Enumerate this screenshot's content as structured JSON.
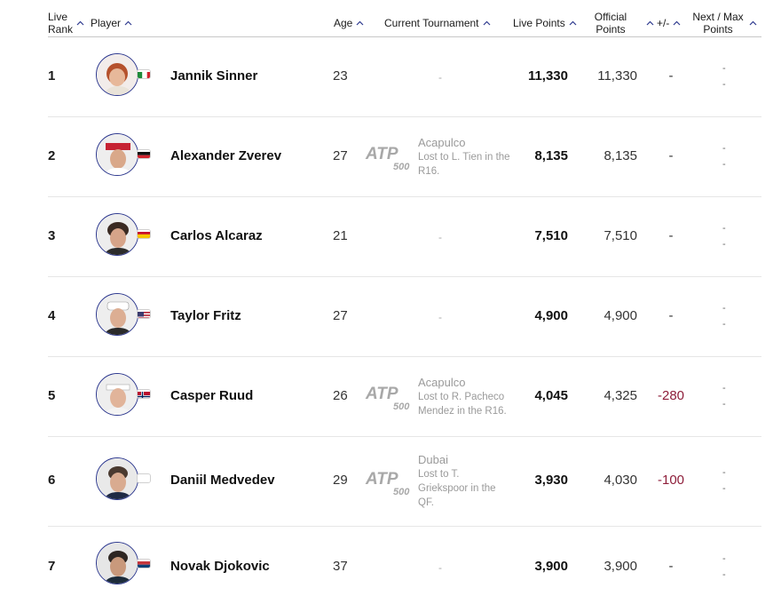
{
  "columns": {
    "live_rank": [
      "Live",
      "Rank"
    ],
    "player": "Player",
    "age": "Age",
    "current_tournament": "Current Tournament",
    "live_points": "Live Points",
    "official_points": [
      "Official",
      "Points"
    ],
    "diff": "+/-",
    "next_max": [
      "Next / Max",
      "Points"
    ]
  },
  "players": [
    {
      "rank": "1",
      "name": "Jannik Sinner",
      "age": "23",
      "tournament": null,
      "live": "11,330",
      "official": "11,330",
      "diff": "-",
      "next": "-",
      "max": "-",
      "flag": "ITA"
    },
    {
      "rank": "2",
      "name": "Alexander Zverev",
      "age": "27",
      "tournament": {
        "name": "Acapulco",
        "result": [
          "Lost to L. Tien in the",
          "R16."
        ]
      },
      "live": "8,135",
      "official": "8,135",
      "diff": "-",
      "next": "-",
      "max": "-",
      "flag": "GER"
    },
    {
      "rank": "3",
      "name": "Carlos Alcaraz",
      "age": "21",
      "tournament": null,
      "live": "7,510",
      "official": "7,510",
      "diff": "-",
      "next": "-",
      "max": "-",
      "flag": "ESP"
    },
    {
      "rank": "4",
      "name": "Taylor Fritz",
      "age": "27",
      "tournament": null,
      "live": "4,900",
      "official": "4,900",
      "diff": "-",
      "next": "-",
      "max": "-",
      "flag": "USA"
    },
    {
      "rank": "5",
      "name": "Casper Ruud",
      "age": "26",
      "tournament": {
        "name": "Acapulco",
        "result": [
          "Lost to R. Pacheco",
          "Mendez in the R16."
        ]
      },
      "live": "4,045",
      "official": "4,325",
      "diff": "-280",
      "next": "-",
      "max": "-",
      "flag": "NOR"
    },
    {
      "rank": "6",
      "name": "Daniil Medvedev",
      "age": "29",
      "tournament": {
        "name": "Dubai",
        "result": [
          "Lost to T.",
          "Griekspoor in the",
          "QF."
        ]
      },
      "live": "3,930",
      "official": "4,030",
      "diff": "-100",
      "next": "-",
      "max": "-",
      "flag": "NONE"
    },
    {
      "rank": "7",
      "name": "Novak Djokovic",
      "age": "37",
      "tournament": null,
      "live": "3,900",
      "official": "3,900",
      "diff": "-",
      "next": "-",
      "max": "-",
      "flag": "SRB"
    }
  ],
  "tournament_logo": {
    "brand": "ATP",
    "tier": "500"
  },
  "empty_tournament": "-",
  "colors": {
    "avatar_ring": "#2f3a8f",
    "negative": "#8e1e3a",
    "header_border": "#c8c8c8"
  },
  "icons": {
    "sort": "chevron-up-icon"
  }
}
